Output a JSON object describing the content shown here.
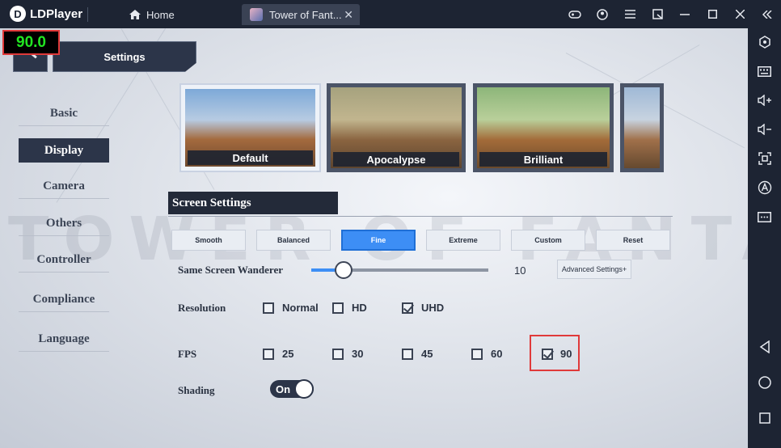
{
  "titlebar": {
    "app_name": "LDPlayer",
    "tabs": [
      {
        "label": "Home"
      },
      {
        "label": "Tower of Fant..."
      }
    ],
    "tab_close": "✕"
  },
  "fps_counter": "90.0",
  "settings": {
    "header": "Settings",
    "menu": [
      "Basic",
      "Display",
      "Camera",
      "Others",
      "Controller",
      "Compliance",
      "Language"
    ],
    "active_menu": "Display",
    "presets": [
      {
        "label": "Default",
        "selected": true
      },
      {
        "label": "Apocalypse",
        "selected": false
      },
      {
        "label": "Brilliant",
        "selected": false
      }
    ],
    "screen_settings": {
      "title": "Screen Settings",
      "quality_buttons": [
        "Smooth",
        "Balanced",
        "Fine",
        "Extreme",
        "Custom",
        "Reset"
      ],
      "active_quality": "Fine",
      "wanderer": {
        "label": "Same Screen Wanderer",
        "value": "10",
        "fraction": 0.18
      },
      "advanced_button": "Advanced Settings+",
      "resolution": {
        "label": "Resolution",
        "options": [
          {
            "label": "Normal",
            "checked": false
          },
          {
            "label": "HD",
            "checked": false
          },
          {
            "label": "UHD",
            "checked": true
          }
        ]
      },
      "fps": {
        "label": "FPS",
        "options": [
          {
            "label": "25",
            "checked": false
          },
          {
            "label": "30",
            "checked": false
          },
          {
            "label": "45",
            "checked": false
          },
          {
            "label": "60",
            "checked": false
          },
          {
            "label": "90",
            "checked": true
          }
        ]
      },
      "shading": {
        "label": "Shading",
        "toggle_text": "On",
        "enabled": true
      }
    }
  },
  "colors": {
    "accent": "#3d8ef5",
    "panel_dark": "#2c3549",
    "fps_text": "#22e522",
    "highlight": "#e03a3a"
  }
}
